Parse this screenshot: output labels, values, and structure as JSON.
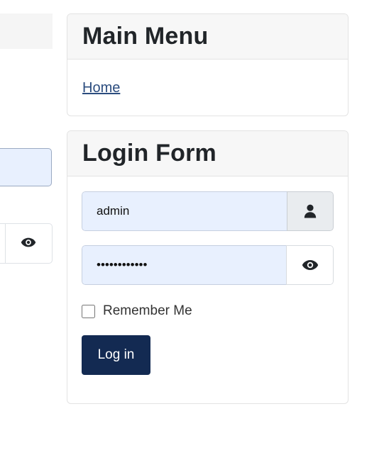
{
  "main_menu": {
    "title": "Main Menu",
    "items": [
      {
        "label": "Home"
      }
    ]
  },
  "login_form": {
    "title": "Login Form",
    "username": {
      "value": "admin",
      "icon": "user-icon"
    },
    "password": {
      "value": "••••••••••••",
      "icon": "eye-icon"
    },
    "remember_me": {
      "label": "Remember Me",
      "checked": false
    },
    "submit_label": "Log in"
  },
  "colors": {
    "input_autofill_bg": "#e8f0fe",
    "button_bg": "#132a52",
    "link": "#2b4c7e",
    "card_header_bg": "#f7f7f7"
  }
}
